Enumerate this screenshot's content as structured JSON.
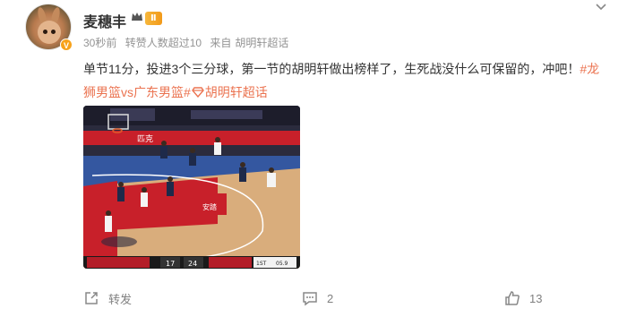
{
  "author": {
    "name": "麦穗丰",
    "level": "Ⅱ",
    "verified_glyph": "V"
  },
  "meta": {
    "time": "30秒前",
    "repost_info": "转赞人数超过10",
    "source_prefix": "来自",
    "source": "胡明轩超话"
  },
  "post": {
    "text": "单节11分，投进3个三分球，第一节的胡明轩做出榜样了，生死战没什么可保留的，冲吧！",
    "tag1": "#龙狮男篮vs广东男篮#",
    "tag2": "胡明轩超话",
    "tag2_icon": "diamond-icon"
  },
  "video": {
    "score_home": "17",
    "score_away": "24",
    "period": "1ST",
    "clock": "05.9",
    "ad_text": "匹克",
    "court_brand": "安踏"
  },
  "actions": {
    "repost_label": "转发",
    "comment_count": "2",
    "like_count": "13"
  },
  "colors": {
    "accent": "#eb7350",
    "court_red": "#c8202a",
    "court_floor": "#d9ad7c"
  }
}
